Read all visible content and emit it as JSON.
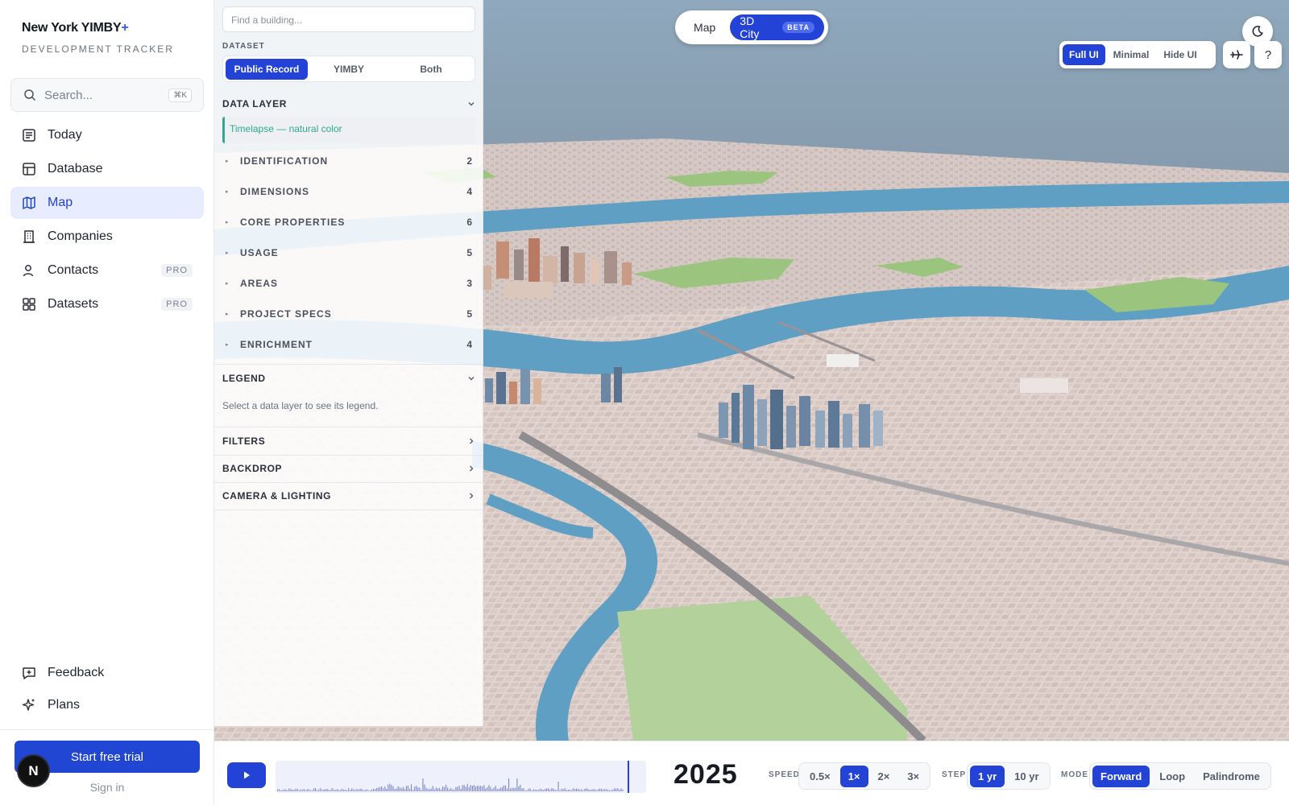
{
  "app": {
    "brand_name": "New York YIMBY",
    "brand_plus": "+",
    "subtitle": "DEVELOPMENT TRACKER"
  },
  "sidebar": {
    "search_placeholder": "Search...",
    "search_shortcut": "⌘K",
    "items": [
      {
        "label": "Today",
        "icon": "newspaper-icon"
      },
      {
        "label": "Database",
        "icon": "table-icon"
      },
      {
        "label": "Map",
        "icon": "map-icon",
        "active": true
      },
      {
        "label": "Companies",
        "icon": "building-icon"
      },
      {
        "label": "Contacts",
        "icon": "user-icon",
        "badge": "PRO"
      },
      {
        "label": "Datasets",
        "icon": "grid-icon",
        "badge": "PRO"
      }
    ],
    "bottom_items": [
      {
        "label": "Feedback",
        "icon": "feedback-icon"
      },
      {
        "label": "Plans",
        "icon": "sparkles-icon"
      }
    ],
    "cta_label": "Start free trial",
    "signin_label": "Sign in",
    "avatar_letter": "N"
  },
  "view_toggle": {
    "map_label": "Map",
    "city_label": "3D City",
    "beta_label": "BETA",
    "active": "3D City"
  },
  "ui_mode": {
    "options": [
      "Full UI",
      "Minimal",
      "Hide UI"
    ],
    "selected": "Full UI",
    "extra_buttons": [
      "plane-icon",
      "help-icon"
    ],
    "help_label": "?"
  },
  "panel": {
    "find_placeholder": "Find a building...",
    "dataset_label": "DATASET",
    "dataset_options": [
      "Public Record",
      "YIMBY",
      "Both"
    ],
    "dataset_selected": "Public Record",
    "data_layer_title": "DATA LAYER",
    "active_layer": "Timelapse — natural color",
    "properties": [
      {
        "label": "IDENTIFICATION",
        "count": "2"
      },
      {
        "label": "DIMENSIONS",
        "count": "4"
      },
      {
        "label": "CORE PROPERTIES",
        "count": "6"
      },
      {
        "label": "USAGE",
        "count": "5"
      },
      {
        "label": "AREAS",
        "count": "3"
      },
      {
        "label": "PROJECT SPECS",
        "count": "5"
      },
      {
        "label": "ENRICHMENT",
        "count": "4"
      }
    ],
    "legend_title": "LEGEND",
    "legend_text": "Select a data layer to see its legend.",
    "collapsed_sections": [
      "FILTERS",
      "BACKDROP",
      "CAMERA & LIGHTING"
    ]
  },
  "timeline": {
    "year": "2025",
    "speed_label": "SPEED",
    "speed_options": [
      "0.5×",
      "1×",
      "2×",
      "3×"
    ],
    "speed_selected": "1×",
    "step_label": "STEP",
    "step_options": [
      "1 yr",
      "10 yr"
    ],
    "step_selected": "1 yr",
    "mode_label": "MODE",
    "mode_options": [
      "Forward",
      "Loop",
      "Palindrome"
    ],
    "mode_selected": "Forward"
  },
  "colors": {
    "accent": "#2343d6",
    "active_nav_bg": "#e7ecff",
    "water": "#5f9fc4",
    "park": "#9bc47f",
    "ground": "#e2d4cf",
    "sky_top": "#8fa8bd",
    "sky_bottom": "#686d74",
    "teal": "#2fa88f"
  }
}
